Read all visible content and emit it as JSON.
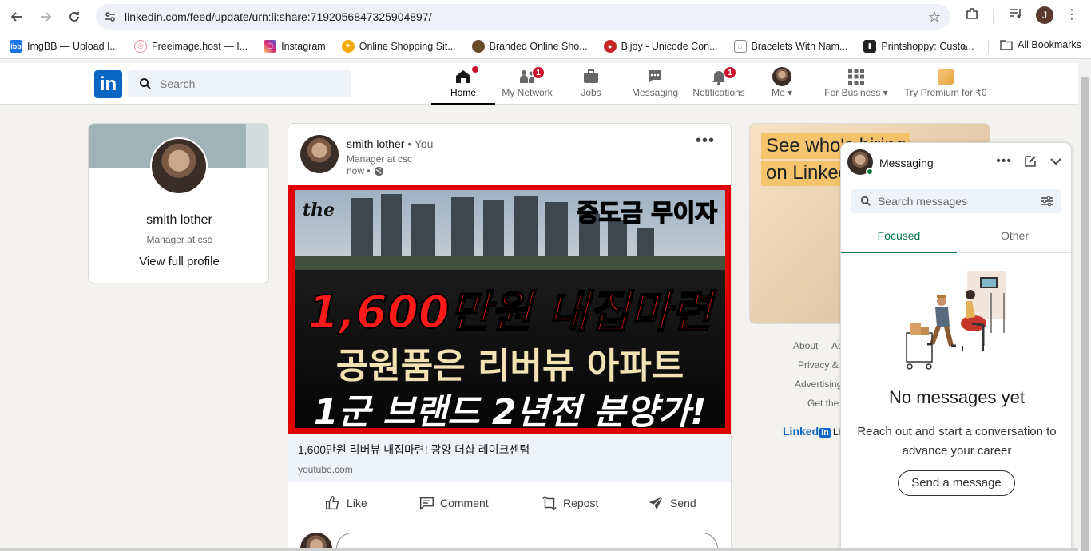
{
  "browser": {
    "url": "linkedin.com/feed/update/urn:li:share:7192056847325904897/",
    "profile_initial": "J"
  },
  "bookmarks": {
    "items": [
      {
        "label": "ImgBB — Upload I...",
        "color": "#1a73e8"
      },
      {
        "label": "Freeimage.host — I...",
        "color": "#e88aa0"
      },
      {
        "label": "Instagram",
        "color": "#d62976"
      },
      {
        "label": "Online Shopping Sit...",
        "color": "#f2a900"
      },
      {
        "label": "Branded Online Sho...",
        "color": "#6b4a2a"
      },
      {
        "label": "Bijoy - Unicode Con...",
        "color": "#c62828"
      },
      {
        "label": "Bracelets With Nam...",
        "color": "#888888"
      },
      {
        "label": "Printshoppy: Custo...",
        "color": "#222222"
      }
    ],
    "all_label": "All Bookmarks"
  },
  "linkedin_nav": {
    "search_placeholder": "Search",
    "items": [
      {
        "label": "Home",
        "badge": ""
      },
      {
        "label": "My Network",
        "badge": "1"
      },
      {
        "label": "Jobs",
        "badge": ""
      },
      {
        "label": "Messaging",
        "badge": ""
      },
      {
        "label": "Notifications",
        "badge": "1"
      },
      {
        "label": "Me",
        "badge": ""
      },
      {
        "label": "For Business",
        "badge": ""
      },
      {
        "label": "Try Premium for ₹0",
        "badge": ""
      }
    ]
  },
  "profile": {
    "name": "smith lother",
    "headline": "Manager at csc",
    "link": "View full profile"
  },
  "post": {
    "author": "smith lother",
    "you": " • You",
    "headline": "Manager at csc",
    "time": "now •",
    "thumbnail": {
      "top_right": "중도금 무이자",
      "logo": "the",
      "line1": "1,600만원 내집마련",
      "line2": "공원품은 리버뷰 아파트",
      "line3": "1군 브랜드 2년전 분양가!"
    },
    "link_title": "1,600만원 리버뷰 내집마련! 광양 더샵 레이크센텀",
    "link_source": "youtube.com",
    "actions": {
      "like": "Like",
      "comment": "Comment",
      "repost": "Repost",
      "send": "Send"
    }
  },
  "ad": {
    "line1": "See who's hiring",
    "line2": "on LinkedIn"
  },
  "footer": {
    "about": "About",
    "ac": "Ac",
    "privacy": "Privacy &",
    "advertising": "Advertising",
    "get_the": "Get the",
    "linkedin": "Linked",
    "lin": "Lin"
  },
  "messaging": {
    "title": "Messaging",
    "search_placeholder": "Search messages",
    "tabs": [
      "Focused",
      "Other"
    ],
    "empty_title": "No messages yet",
    "empty_sub": "Reach out and start a conversation to advance your career",
    "send_button": "Send a message"
  }
}
